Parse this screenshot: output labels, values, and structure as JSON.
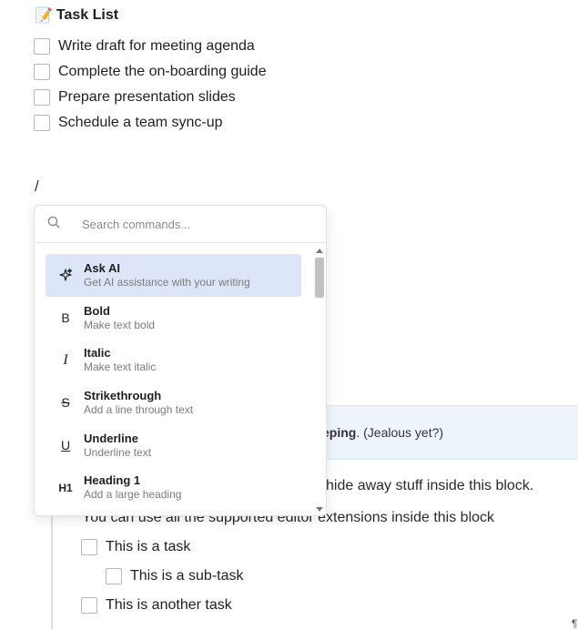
{
  "title": {
    "emoji": "📝",
    "text": "Task List"
  },
  "tasks": [
    "Write draft for meeting agenda",
    "Complete the on-boarding guide",
    "Prepare presentation slides",
    "Schedule a team sync-up"
  ],
  "slash": "/",
  "background": {
    "callout_bold": "eping",
    "callout_rest": ". (Jealous yet?)",
    "line_1": "hide away stuff inside this block.",
    "line_2": "You can use all the supported editor extensions inside this block",
    "subtasks": [
      "This is a task",
      "This is a sub-task",
      "This is another task"
    ],
    "pilcrow": "¶"
  },
  "menu": {
    "search_placeholder": "Search commands...",
    "items": [
      {
        "label": "Ask AI",
        "desc": "Get AI assistance with your writing",
        "icon": "sparkles-icon",
        "glyph": "✧",
        "active": true
      },
      {
        "label": "Bold",
        "desc": "Make text bold",
        "icon": "bold-icon",
        "glyph": "B"
      },
      {
        "label": "Italic",
        "desc": "Make text italic",
        "icon": "italic-icon",
        "glyph": "I"
      },
      {
        "label": "Strikethrough",
        "desc": "Add a line through text",
        "icon": "strikethrough-icon",
        "glyph": "S"
      },
      {
        "label": "Underline",
        "desc": "Underline text",
        "icon": "underline-icon",
        "glyph": "U"
      },
      {
        "label": "Heading 1",
        "desc": "Add a large heading",
        "icon": "heading-1-icon",
        "glyph": "H1"
      }
    ]
  }
}
